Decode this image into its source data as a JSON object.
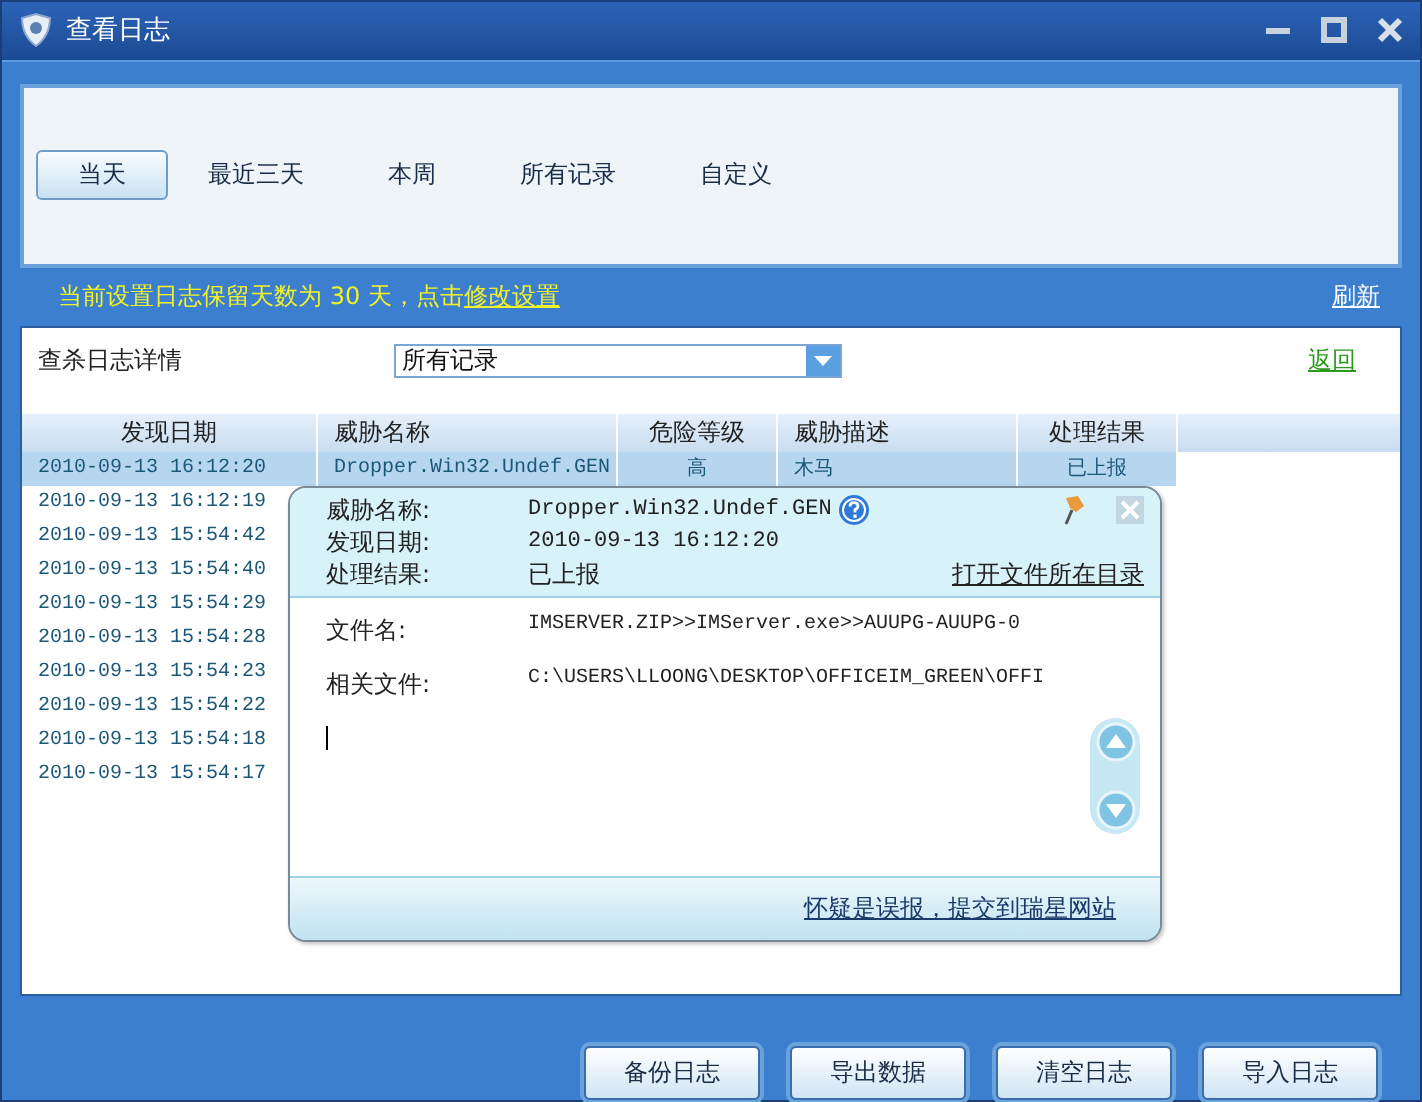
{
  "window": {
    "title": "查看日志"
  },
  "tabs": [
    {
      "label": "当天",
      "selected": true
    },
    {
      "label": "最近三天",
      "selected": false
    },
    {
      "label": "本周",
      "selected": false
    },
    {
      "label": "所有记录",
      "selected": false
    },
    {
      "label": "自定义",
      "selected": false
    }
  ],
  "retention_notice": {
    "text": "当前设置日志保留天数为 30 天，点击",
    "link": "修改设置"
  },
  "refresh_link": "刷新",
  "filter": {
    "label": "查杀日志详情",
    "value": "所有记录"
  },
  "back_link": "返回",
  "table": {
    "columns": [
      "发现日期",
      "威胁名称",
      "危险等级",
      "威胁描述",
      "处理结果"
    ],
    "rows": [
      {
        "date": "2010-09-13 16:12:20",
        "name": "Dropper.Win32.Undef.GEN",
        "level": "高",
        "desc": "木马",
        "result": "已上报",
        "selected": true
      },
      {
        "date": "2010-09-13 16:12:19",
        "selected": false
      },
      {
        "date": "2010-09-13 15:54:42",
        "selected": false
      },
      {
        "date": "2010-09-13 15:54:40",
        "selected": false
      },
      {
        "date": "2010-09-13 15:54:29",
        "selected": false
      },
      {
        "date": "2010-09-13 15:54:28",
        "selected": false
      },
      {
        "date": "2010-09-13 15:54:23",
        "selected": false
      },
      {
        "date": "2010-09-13 15:54:22",
        "selected": false
      },
      {
        "date": "2010-09-13 15:54:18",
        "selected": false
      },
      {
        "date": "2010-09-13 15:54:17",
        "selected": false
      }
    ]
  },
  "popup": {
    "summary": [
      {
        "label": "威胁名称:",
        "value": "Dropper.Win32.Undef.GEN",
        "kind": "threat"
      },
      {
        "label": "发现日期:",
        "value": "2010-09-13 16:12:20",
        "kind": "date"
      },
      {
        "label": "处理结果:",
        "value": "已上报",
        "kind": "result"
      }
    ],
    "open_folder_link": "打开文件所在目录",
    "details": [
      {
        "label": "文件名:",
        "value": "IMSERVER.ZIP>>IMServer.exe>>AUUPG-AUUPG-0"
      },
      {
        "label": "相关文件:",
        "value": "C:\\USERS\\LLOONG\\DESKTOP\\OFFICEIM_GREEN\\OFFI"
      }
    ],
    "report_link": "怀疑是误报，提交到瑞星网站"
  },
  "buttons": [
    "备份日志",
    "导出数据",
    "清空日志",
    "导入日志"
  ]
}
